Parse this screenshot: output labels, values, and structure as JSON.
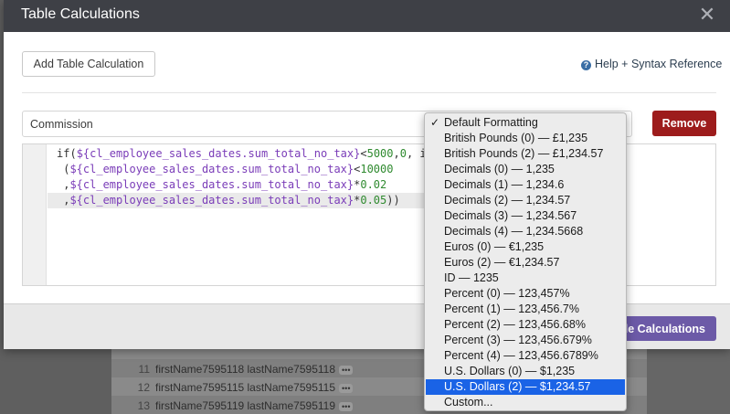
{
  "modal": {
    "title": "Table Calculations",
    "add_button": "Add Table Calculation",
    "help_link": "Help + Syntax Reference",
    "name_value": "Commission",
    "remove_button": "Remove",
    "save_button": "ble Calculations"
  },
  "code": {
    "line1_a": "if(",
    "line1_b": "${cl_employee_sales_dates.sum_total_no_tax}",
    "line1_c": "<",
    "line1_d": "5000",
    "line1_e": ",",
    "line1_f": "0",
    "line1_g": ", i",
    "line2_a": " (",
    "line2_b": "${cl_employee_sales_dates.sum_total_no_tax}",
    "line2_c": "<",
    "line2_d": "10000",
    "line3_a": " ,",
    "line3_b": "${cl_employee_sales_dates.sum_total_no_tax}",
    "line3_c": "*",
    "line3_d": "0.02",
    "line4_a": " ,",
    "line4_b": "${cl_employee_sales_dates.sum_total_no_tax}",
    "line4_c": "*",
    "line4_d": "0.05",
    "line4_e": "))"
  },
  "format_dropdown": {
    "check_mark": "✓",
    "items": [
      "Default Formatting",
      "British Pounds (0) — £1,235",
      "British Pounds (2) — £1,234.57",
      "Decimals (0) — 1,235",
      "Decimals (1) — 1,234.6",
      "Decimals (2) — 1,234.57",
      "Decimals (3) — 1,234.567",
      "Decimals (4) — 1,234.5668",
      "Euros (0) — €1,235",
      "Euros (2) — €1,234.57",
      "ID — 1235",
      "Percent (0) — 123,457%",
      "Percent (1) — 123,456.7%",
      "Percent (2) — 123,456.68%",
      "Percent (3) — 123,456.679%",
      "Percent (4) — 123,456.6789%",
      "U.S. Dollars (0) — $1,235",
      "U.S. Dollars (2) — $1,234.57",
      "Custom..."
    ],
    "checked_index": 0,
    "highlighted_index": 17
  },
  "background_rows": [
    {
      "num": "11",
      "text": "firstName7595118 lastName7595118",
      "dots": "•••"
    },
    {
      "num": "12",
      "text": "firstName7595115 lastName7595115",
      "dots": "•••"
    },
    {
      "num": "13",
      "text": "firstName7595119 lastName7595119",
      "dots": "•••"
    }
  ],
  "colors": {
    "header_bg": "#3e4046",
    "remove_bg": "#9d1c1c",
    "save_bg": "#6c5aa7",
    "highlight": "#1a63e6"
  }
}
